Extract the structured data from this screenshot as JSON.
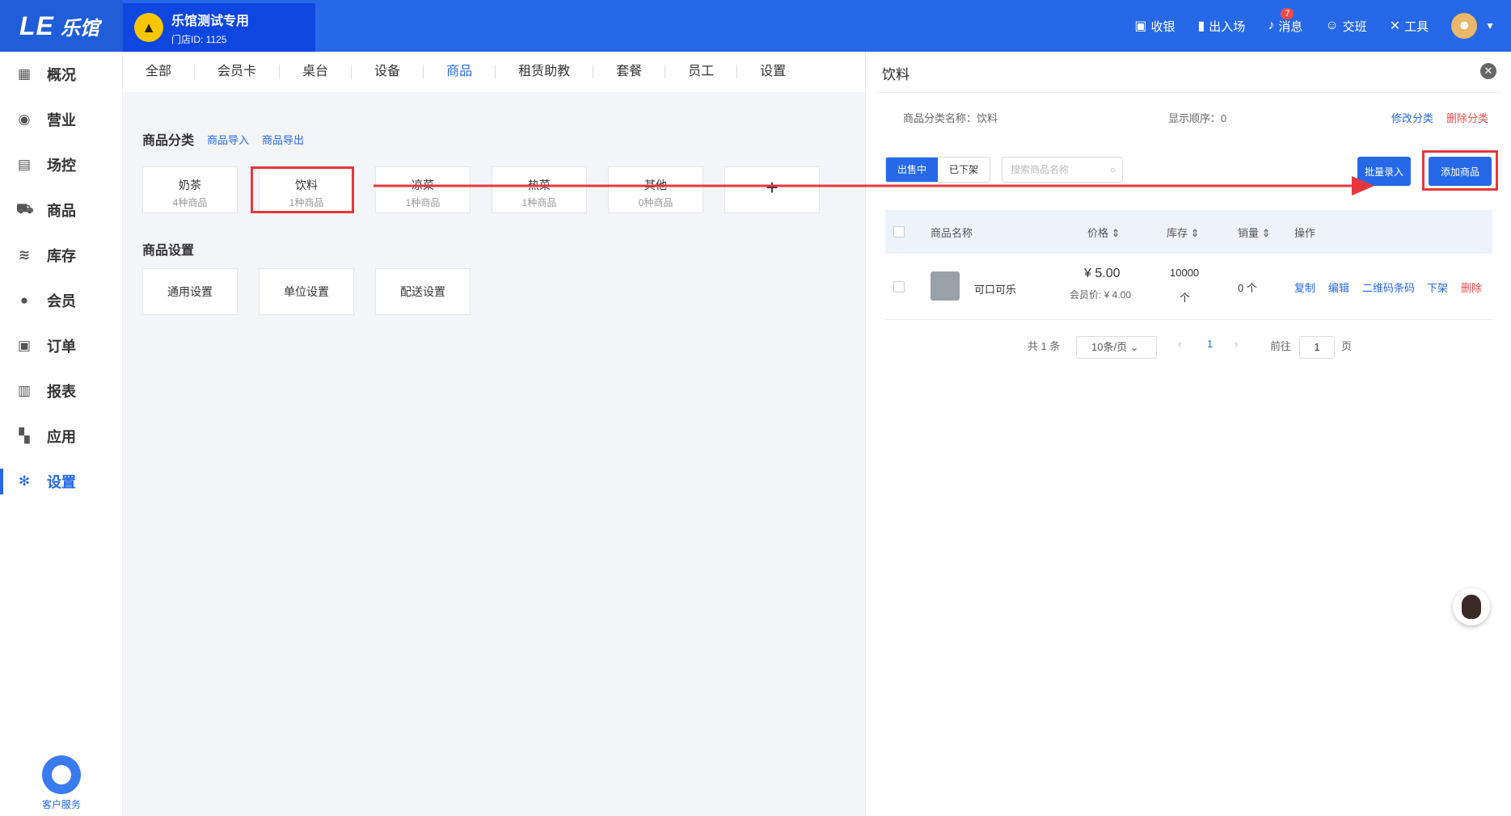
{
  "topbar": {
    "logo_mark": "LE",
    "logo_brand": "乐馆",
    "store_name": "乐馆测试专用",
    "store_id": "门店ID: 1125",
    "tools": [
      {
        "label": "收银",
        "icon": "cashier-icon"
      },
      {
        "label": "出入场",
        "icon": "door-icon"
      },
      {
        "label": "消息",
        "icon": "bell-icon",
        "badge": "7"
      },
      {
        "label": "交班",
        "icon": "handover-icon"
      },
      {
        "label": "工具",
        "icon": "tools-icon"
      }
    ]
  },
  "sidebar": {
    "items": [
      {
        "label": "概况",
        "icon": "chart-icon",
        "glyph": "▦"
      },
      {
        "label": "营业",
        "icon": "moneybag-icon",
        "glyph": "◉"
      },
      {
        "label": "场控",
        "icon": "monitor-icon",
        "glyph": "▤"
      },
      {
        "label": "商品",
        "icon": "cart-icon",
        "glyph": "⛟"
      },
      {
        "label": "库存",
        "icon": "layers-icon",
        "glyph": "≋"
      },
      {
        "label": "会员",
        "icon": "user-icon",
        "glyph": "●"
      },
      {
        "label": "订单",
        "icon": "order-icon",
        "glyph": "▣"
      },
      {
        "label": "报表",
        "icon": "bars-icon",
        "glyph": "▥"
      },
      {
        "label": "应用",
        "icon": "apps-icon",
        "glyph": "▚"
      },
      {
        "label": "设置",
        "icon": "gear-icon",
        "glyph": "✻",
        "active": true
      }
    ],
    "service_label": "客户服务"
  },
  "tabs": [
    "全部",
    "会员卡",
    "桌台",
    "设备",
    "商品",
    "租赁助教",
    "套餐",
    "员工",
    "设置"
  ],
  "active_tab": "商品",
  "categories": {
    "title": "商品分类",
    "import_link": "商品导入",
    "export_link": "商品导出",
    "cards": [
      {
        "name": "奶茶",
        "count": "4种商品"
      },
      {
        "name": "饮料",
        "count": "1种商品"
      },
      {
        "name": "凉菜",
        "count": "1种商品"
      },
      {
        "name": "热菜",
        "count": "1种商品"
      },
      {
        "name": "其他",
        "count": "0种商品"
      }
    ],
    "add_glyph": "+"
  },
  "settings": {
    "title": "商品设置",
    "cards": [
      "通用设置",
      "单位设置",
      "配送设置"
    ]
  },
  "panel": {
    "title": "饮料",
    "category_name_label": "商品分类名称：饮料",
    "display_order_label": "显示顺序：0",
    "edit_category": "修改分类",
    "delete_category": "删除分类",
    "seg_on_sale": "出售中",
    "seg_off_shelf": "已下架",
    "search_placeholder": "搜索商品名称",
    "batch_button": "批量录入",
    "add_button": "添加商品",
    "columns": {
      "name": "商品名称",
      "price": "价格",
      "stock": "库存",
      "sales": "销量",
      "ops": "操作"
    },
    "rows": [
      {
        "name": "可口可乐",
        "price": "¥ 5.00",
        "member_price": "会员价: ¥ 4.00",
        "stock": "10000",
        "stock_unit": "个",
        "sales": "0 个",
        "ops": [
          "复制",
          "编辑",
          "二维码条码",
          "下架",
          "删除"
        ]
      }
    ],
    "pager": {
      "total": "共 1 条",
      "page_size": "10条/页",
      "current": "1",
      "goto_label": "前往",
      "goto_value": "1",
      "page_suffix": "页"
    }
  },
  "colors": {
    "accent": "#2668e8",
    "highlight": "#e8373c",
    "danger": "#f54b4b"
  }
}
